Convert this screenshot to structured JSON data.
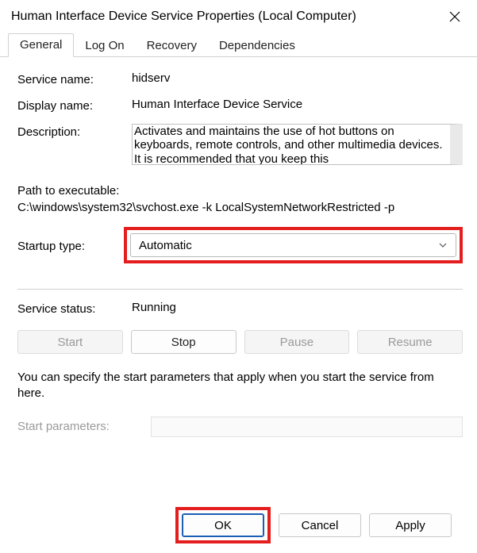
{
  "window": {
    "title": "Human Interface Device Service Properties (Local Computer)"
  },
  "tabs": {
    "general": "General",
    "logon": "Log On",
    "recovery": "Recovery",
    "dependencies": "Dependencies"
  },
  "labels": {
    "service_name": "Service name:",
    "display_name": "Display name:",
    "description": "Description:",
    "path_label": "Path to executable:",
    "startup_type": "Startup type:",
    "service_status": "Service status:",
    "start_parameters": "Start parameters:"
  },
  "values": {
    "service_name": "hidserv",
    "display_name": "Human Interface Device Service",
    "description": "Activates and maintains the use of hot buttons on keyboards, remote controls, and other multimedia devices. It is recommended that you keep this",
    "path": "C:\\windows\\system32\\svchost.exe -k LocalSystemNetworkRestricted -p",
    "startup_selected": "Automatic",
    "service_status": "Running"
  },
  "buttons": {
    "start": "Start",
    "stop": "Stop",
    "pause": "Pause",
    "resume": "Resume",
    "ok": "OK",
    "cancel": "Cancel",
    "apply": "Apply"
  },
  "note": "You can specify the start parameters that apply when you start the service from here."
}
